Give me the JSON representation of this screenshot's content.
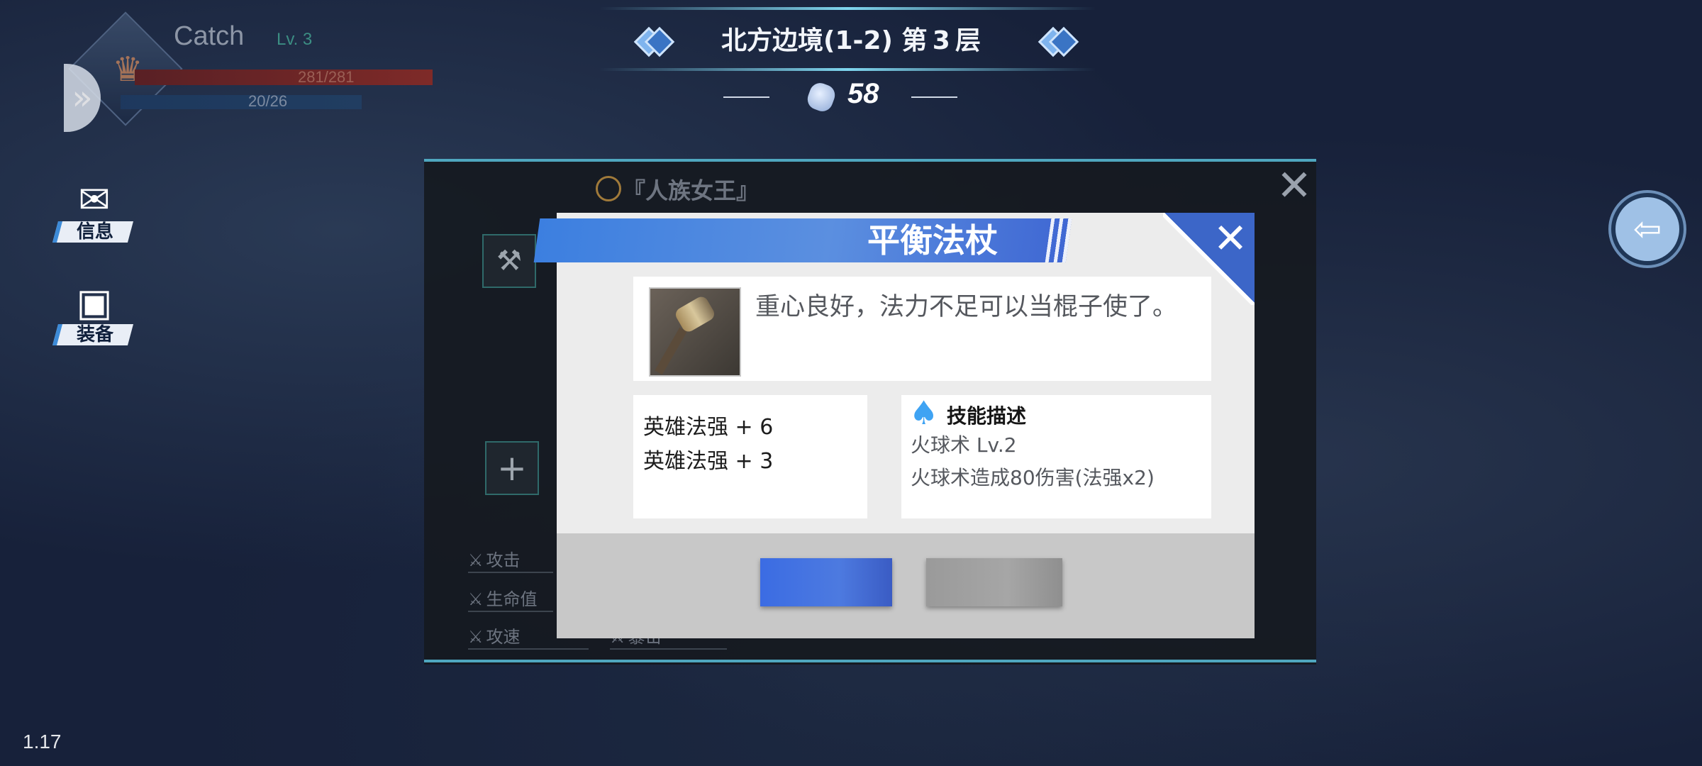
{
  "player": {
    "name": "Catch",
    "level": "Lv. 3",
    "hp": "281/281",
    "mp": "20/26"
  },
  "side_buttons": {
    "info_label": "信息",
    "equip_label": "装备"
  },
  "stage": {
    "title": "北方边境(1-2) 第 3 层",
    "currency": "58"
  },
  "equip_panel": {
    "hero_title": "『人族女王』",
    "stats": [
      "攻击",
      "生命值",
      "攻速",
      "暴击"
    ]
  },
  "item_dialog": {
    "title": "平衡法杖",
    "description": "重心良好，法力不足可以当棍子使了。",
    "bonuses": [
      "英雄法强 + 6",
      "英雄法强 + 3"
    ],
    "skill_header": "技能描述",
    "skill_name": "火球术 Lv.2",
    "skill_effect": "火球术造成80伤害(法强x2)"
  },
  "version": "1.17",
  "colors": {
    "accent_blue": "#3c7fe0",
    "panel_line": "#4fa7bf",
    "spade_blue": "#3fa3f3"
  },
  "icons": [
    "expand-arrow-icon",
    "mail-icon",
    "toolbox-icon",
    "diamond-icon",
    "gem-icon",
    "exit-door-icon",
    "close-icon",
    "shield-badge-icon",
    "staff-icon",
    "plus-icon",
    "crossed-swords-icon",
    "spade-icon"
  ]
}
